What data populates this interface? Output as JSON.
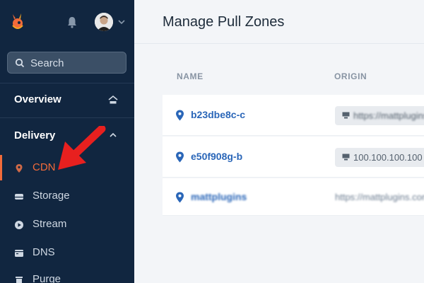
{
  "sidebar": {
    "search_label": "Search",
    "sections": [
      {
        "title": "Overview",
        "icon": "home-icon"
      },
      {
        "title": "Delivery",
        "icon": "chevron-up-icon"
      }
    ],
    "items": [
      {
        "label": "CDN",
        "icon": "location-pin-icon",
        "active": true
      },
      {
        "label": "Storage",
        "icon": "storage-icon"
      },
      {
        "label": "Stream",
        "icon": "play-icon"
      },
      {
        "label": "DNS",
        "icon": "dns-icon"
      },
      {
        "label": "Purge",
        "icon": "trash-icon"
      }
    ]
  },
  "main": {
    "title": "Manage Pull Zones",
    "columns": [
      "NAME",
      "ORIGIN"
    ],
    "rows": [
      {
        "name": "b23dbe8c-c",
        "origin": "https://mattplugins.com"
      },
      {
        "name": "e50f908g-b",
        "origin": "100.100.100.100"
      },
      {
        "name": "mattplugins",
        "origin": "https://mattplugins.com"
      }
    ]
  },
  "colors": {
    "sidebar_bg": "#112640",
    "accent": "#f26b3a",
    "link": "#2a66b8",
    "annotation_arrow": "#e8201f"
  }
}
